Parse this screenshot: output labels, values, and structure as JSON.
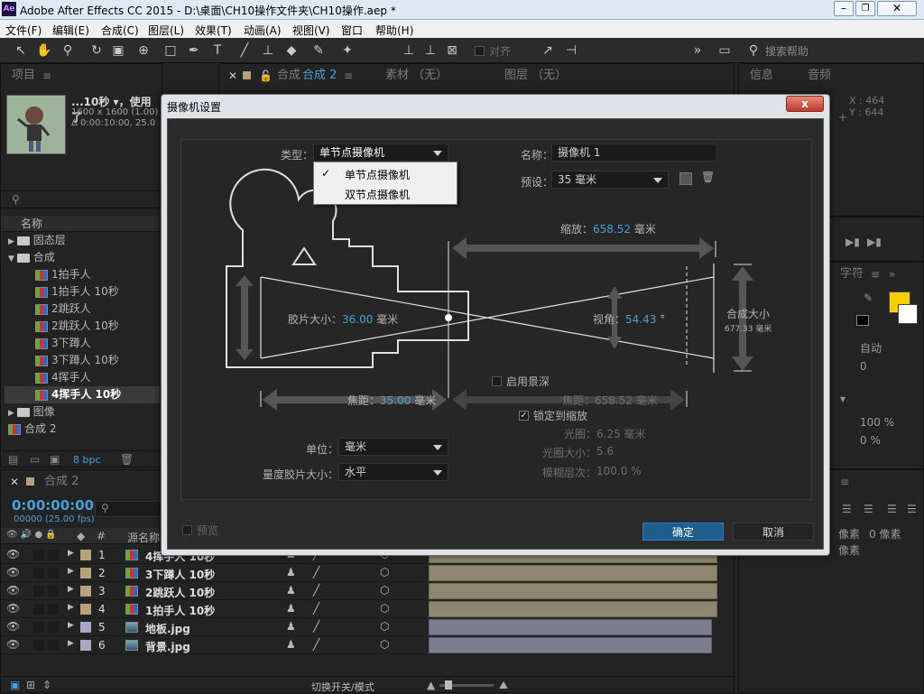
{
  "window": {
    "title": "Adobe After Effects CC 2015 - D:\\桌面\\CH10操作文件夹\\CH10操作.aep *",
    "app_icon": "Ae"
  },
  "menu": [
    "文件(F)",
    "编辑(E)",
    "合成(C)",
    "图层(L)",
    "效果(T)",
    "动画(A)",
    "视图(V)",
    "窗口",
    "帮助(H)"
  ],
  "toolbar": {
    "snap_label": "对齐",
    "search_placeholder": "搜索帮助"
  },
  "project_panel": {
    "tab": "项目",
    "comp_name": "...10秒 ▾，使用了",
    "comp_size": "1600 x 1600 (1.00)",
    "comp_duration": "Δ 0:00:10:00, 25.0",
    "column_name": "名称",
    "bpc": "8 bpc",
    "items": [
      {
        "type": "folder",
        "label": "固态层",
        "expanded": false,
        "indent": 0
      },
      {
        "type": "folder",
        "label": "合成",
        "expanded": true,
        "indent": 0
      },
      {
        "type": "comp",
        "label": "1拍手人",
        "indent": 1
      },
      {
        "type": "comp",
        "label": "1拍手人 10秒",
        "indent": 1
      },
      {
        "type": "comp",
        "label": "2跳跃人",
        "indent": 1
      },
      {
        "type": "comp",
        "label": "2跳跃人 10秒",
        "indent": 1
      },
      {
        "type": "comp",
        "label": "3下蹲人",
        "indent": 1
      },
      {
        "type": "comp",
        "label": "3下蹲人 10秒",
        "indent": 1
      },
      {
        "type": "comp",
        "label": "4挥手人",
        "indent": 1
      },
      {
        "type": "comp",
        "label": "4挥手人 10秒",
        "indent": 1,
        "selected": true
      },
      {
        "type": "folder",
        "label": "图像",
        "expanded": false,
        "indent": 0
      },
      {
        "type": "comp",
        "label": "合成 2",
        "indent": 0
      }
    ]
  },
  "viewer_tabs": {
    "comp_prefix": "合成",
    "comp_tab": "合成 2",
    "footage_tab": "素材 （无）",
    "layer_tab": "图层 （无）"
  },
  "info_panel": {
    "tab_info": "信息",
    "tab_audio": "音频",
    "x": "X : 464",
    "y": "Y : 644"
  },
  "character_panel": {
    "tab": "字符",
    "auto": "自动",
    "tracking": "0",
    "scale": "100 %",
    "baseline": "0 %",
    "pixel1": "像素",
    "pixel2": "像素",
    "pixel_val": "0 像素"
  },
  "timeline": {
    "tab": "合成 2",
    "timecode": "0:00:00:00",
    "frames": "00000 (25.00 fps)",
    "col_hash": "#",
    "col_source": "源名称",
    "bottom_label": "切换开关/模式",
    "layers": [
      {
        "num": "1",
        "name": "4挥手人 10秒",
        "type": "comp"
      },
      {
        "num": "2",
        "name": "3下蹲人 10秒",
        "type": "comp"
      },
      {
        "num": "3",
        "name": "2跳跃人 10秒",
        "type": "comp"
      },
      {
        "num": "4",
        "name": "1拍手人 10秒",
        "type": "comp"
      },
      {
        "num": "5",
        "name": "地板.jpg",
        "type": "image"
      },
      {
        "num": "6",
        "name": "背景.jpg",
        "type": "image"
      }
    ]
  },
  "dialog": {
    "title": "摄像机设置",
    "type_label": "类型：",
    "type_value": "单节点摄像机",
    "type_options": [
      {
        "label": "单节点摄像机",
        "checked": true
      },
      {
        "label": "双节点摄像机",
        "checked": false
      }
    ],
    "name_label": "名称：",
    "name_value": "摄像机 1",
    "preset_label": "预设：",
    "preset_value": "35 毫米",
    "zoom_label": "缩放：",
    "zoom_value": "658.52",
    "zoom_unit": "毫米",
    "film_label": "胶片大小：",
    "film_value": "36.00",
    "film_unit": "毫米",
    "angle_label": "视角：",
    "angle_value": "54.43",
    "angle_unit": "°",
    "comp_size_label": "合成大小",
    "comp_size_value": "677.33 毫米",
    "dof_label": "启用景深",
    "focal_label": "焦距：",
    "focal_value": "35.00",
    "focal_unit": "毫米",
    "focus_dist_label": "焦距：",
    "focus_dist_value": "658.52 毫米",
    "lock_zoom_label": "锁定到缩放",
    "aperture_label": "光圈：",
    "aperture_value": "6.25 毫米",
    "fstop_label": "光圈大小：",
    "fstop_value": "5.6",
    "blur_label": "模糊层次：",
    "blur_value": "100.0 %",
    "units_label": "单位：",
    "units_value": "毫米",
    "measure_label": "量度胶片大小：",
    "measure_value": "水平",
    "preview_label": "预览",
    "ok_label": "确定",
    "cancel_label": "取消",
    "close_label": "x"
  },
  "colors": {
    "accent": "#2d8ceb",
    "ok_button": "#1f5d8c",
    "value_blue": "#4a9fd8",
    "swatch_yellow": "#f5d000"
  }
}
